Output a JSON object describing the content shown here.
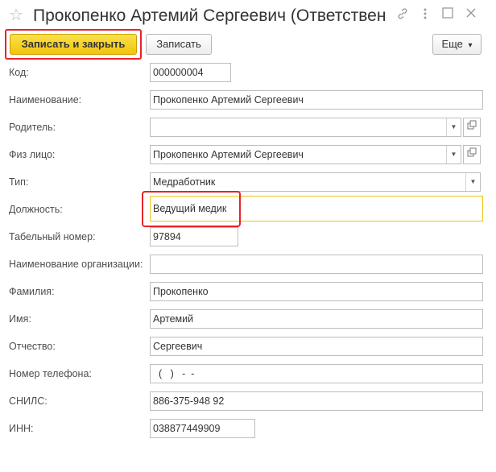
{
  "window": {
    "title": "Прокопенко Артемий Сергеевич (Ответственн...",
    "star_icon": "☆",
    "link_icon": "link-icon",
    "menu_icon": "more-vert-icon",
    "restore_icon": "restore-window-icon",
    "close_icon": "close-icon"
  },
  "toolbar": {
    "save_close_label": "Записать и закрыть",
    "save_label": "Записать",
    "more_label": "Еще",
    "more_arrow": "▾"
  },
  "form": {
    "code": {
      "label": "Код:",
      "value": "000000004"
    },
    "name": {
      "label": "Наименование:",
      "value": "Прокопенко Артемий Сергеевич"
    },
    "parent": {
      "label": "Родитель:",
      "value": ""
    },
    "person": {
      "label": "Физ лицо:",
      "value": "Прокопенко Артемий Сергеевич"
    },
    "type": {
      "label": "Тип:",
      "value": "Медработник"
    },
    "position": {
      "label": "Должность:",
      "value": "Ведущий медик"
    },
    "tab_number": {
      "label": "Табельный номер:",
      "value": "97894"
    },
    "org_name": {
      "label": "Наименование организации:",
      "value": ""
    },
    "last_name": {
      "label": "Фамилия:",
      "value": "Прокопенко"
    },
    "first_name": {
      "label": "Имя:",
      "value": "Артемий"
    },
    "patronymic": {
      "label": "Отчество:",
      "value": "Сергеевич"
    },
    "phone": {
      "label": "Номер телефона:",
      "value": "(   )   -  -"
    },
    "snils": {
      "label": "СНИЛС:",
      "value": "886-375-948 92"
    },
    "inn": {
      "label": "ИНН:",
      "value": "038877449909"
    }
  },
  "colors": {
    "primary_button": "#f1c40c",
    "highlight": "#e8222a",
    "active_field_border": "#f0c419"
  }
}
